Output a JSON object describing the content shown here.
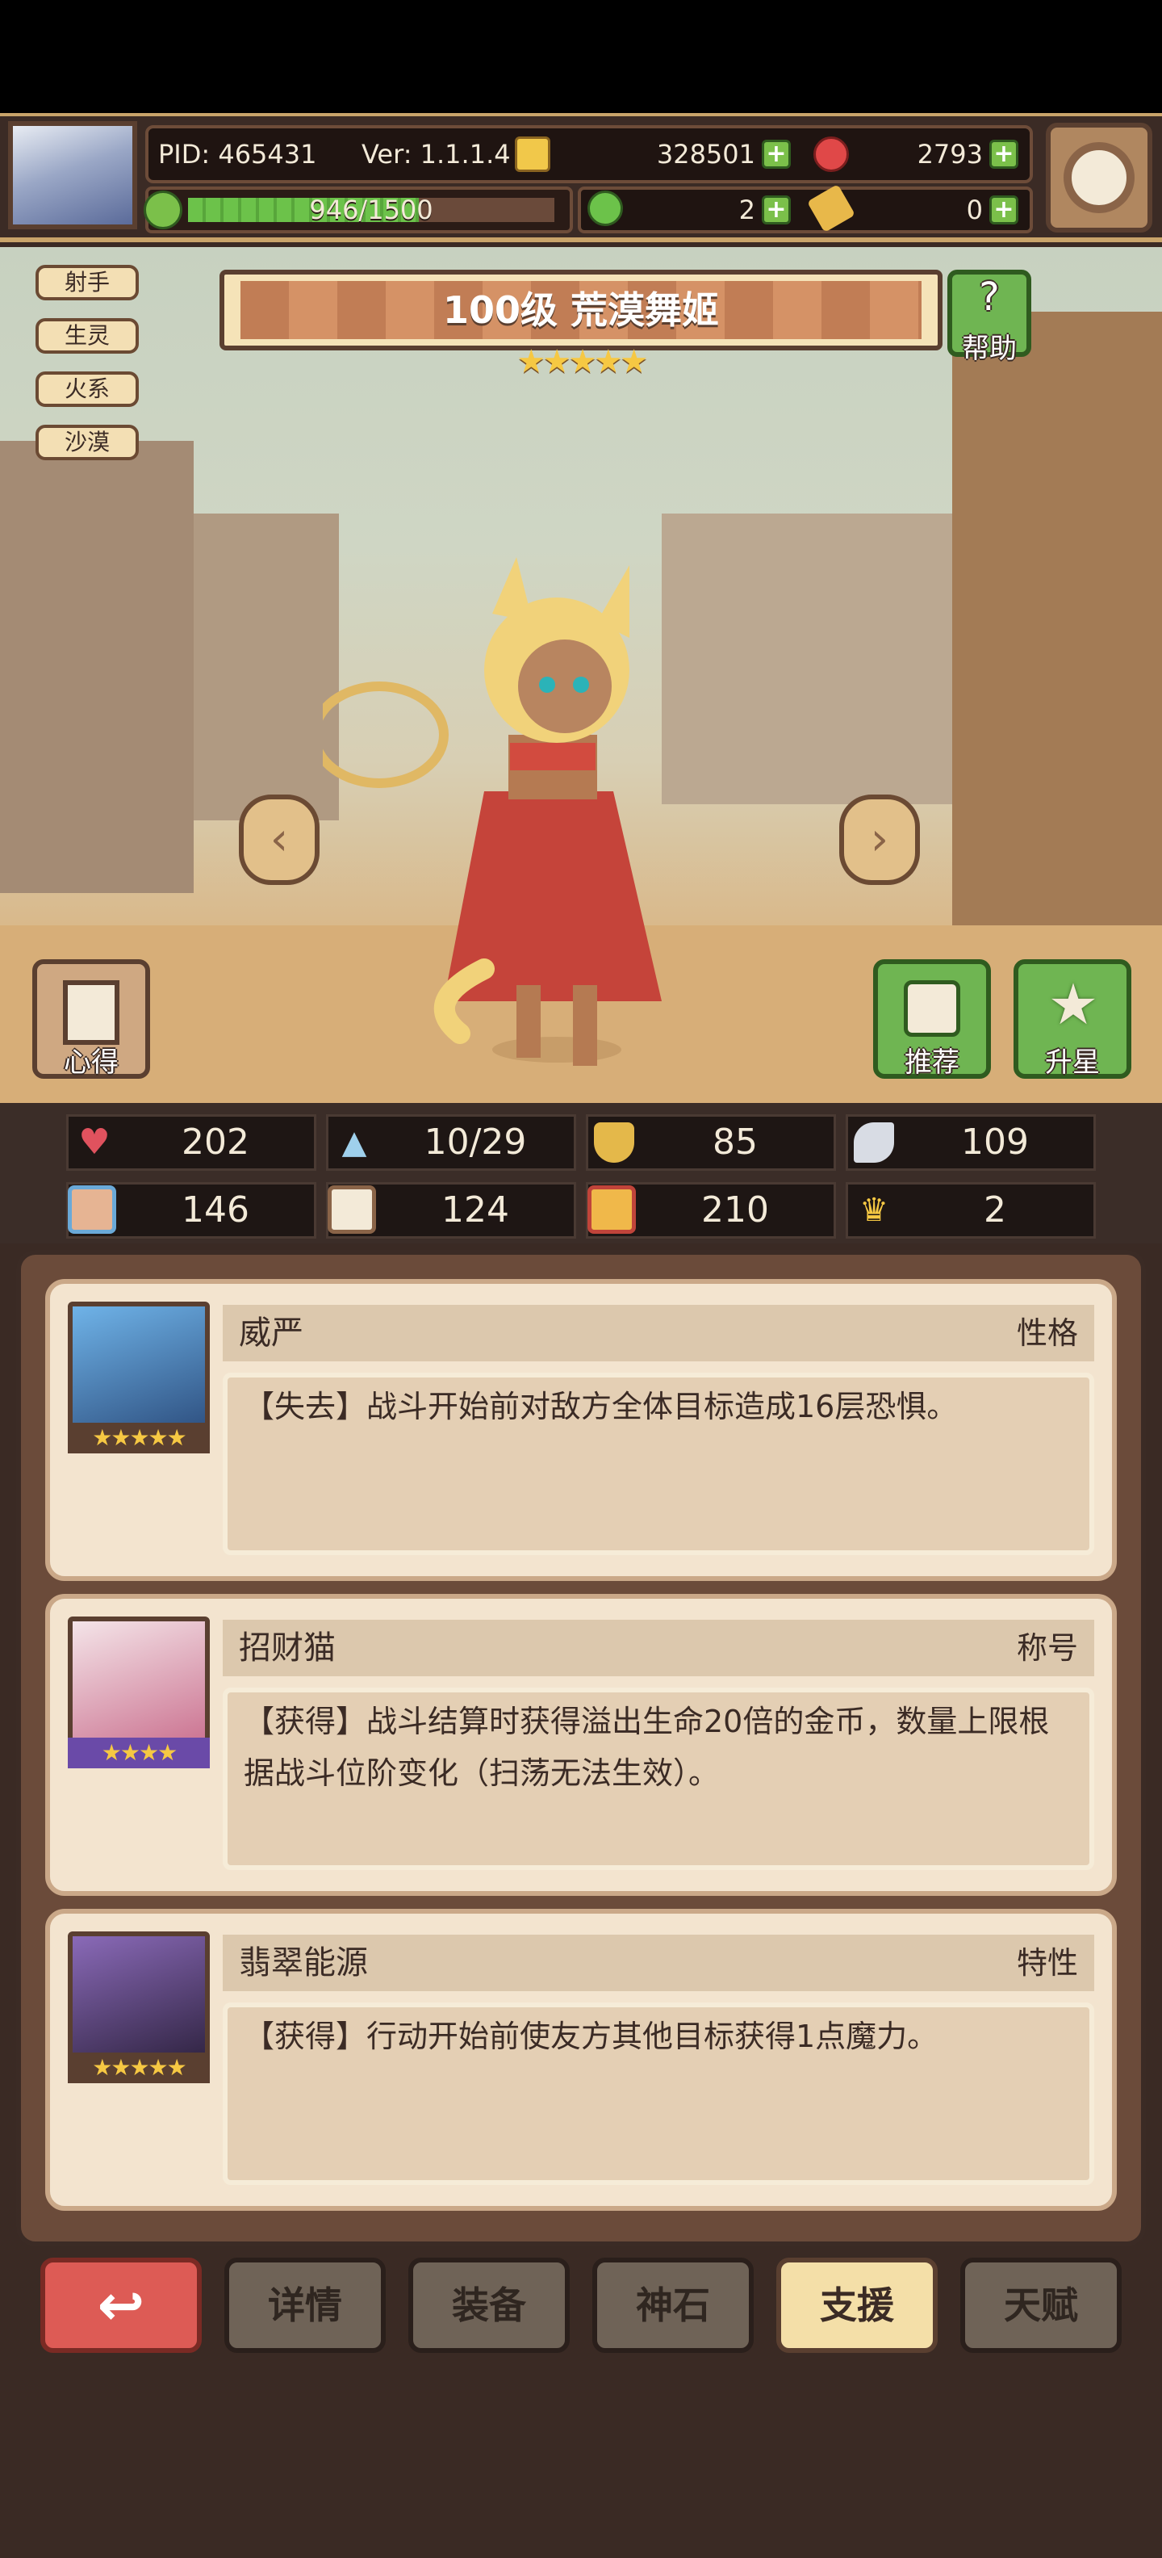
{
  "header": {
    "pid": "PID: 465431",
    "version": "Ver: 1.1.1.4",
    "gold": "328501",
    "gems": "2793",
    "energy": "946/1500",
    "energy_fill": 0.631,
    "clover": "2",
    "key": "0"
  },
  "tags": [
    "射手",
    "生灵",
    "火系",
    "沙漠"
  ],
  "title": {
    "text": "100级  荒漠舞姬",
    "stars": "★★★★★"
  },
  "buttons": {
    "help": "帮助",
    "insight": "心得",
    "recommend": "推荐",
    "star_up": "升星"
  },
  "stats": [
    {
      "icon": "heart-icon",
      "value": "202"
    },
    {
      "icon": "water-drop-icon",
      "value": "10/29"
    },
    {
      "icon": "shield-icon",
      "value": "85"
    },
    {
      "icon": "wing-icon",
      "value": "109"
    },
    {
      "icon": "fist-icon",
      "value": "146"
    },
    {
      "icon": "book-icon",
      "value": "124"
    },
    {
      "icon": "boot-icon",
      "value": "210"
    },
    {
      "icon": "crown-icon",
      "value": "2"
    }
  ],
  "cards": [
    {
      "name": "威严",
      "kind": "性格",
      "desc": "【失去】战斗开始前对敌方全体目标造成16层恐惧。",
      "stars": "★★★★★"
    },
    {
      "name": "招财猫",
      "kind": "称号",
      "desc": "【获得】战斗结算时获得溢出生命20倍的金币，数量上限根据战斗位阶变化（扫荡无法生效）。",
      "stars": "★★★★"
    },
    {
      "name": "翡翠能源",
      "kind": "特性",
      "desc": "【获得】行动开始前使友方其他目标获得1点魔力。",
      "stars": "★★★★★"
    }
  ],
  "nav": {
    "back_icon": "↩",
    "details": "详情",
    "equipment": "装备",
    "godstone": "神石",
    "support": "支援",
    "talent": "天赋"
  }
}
